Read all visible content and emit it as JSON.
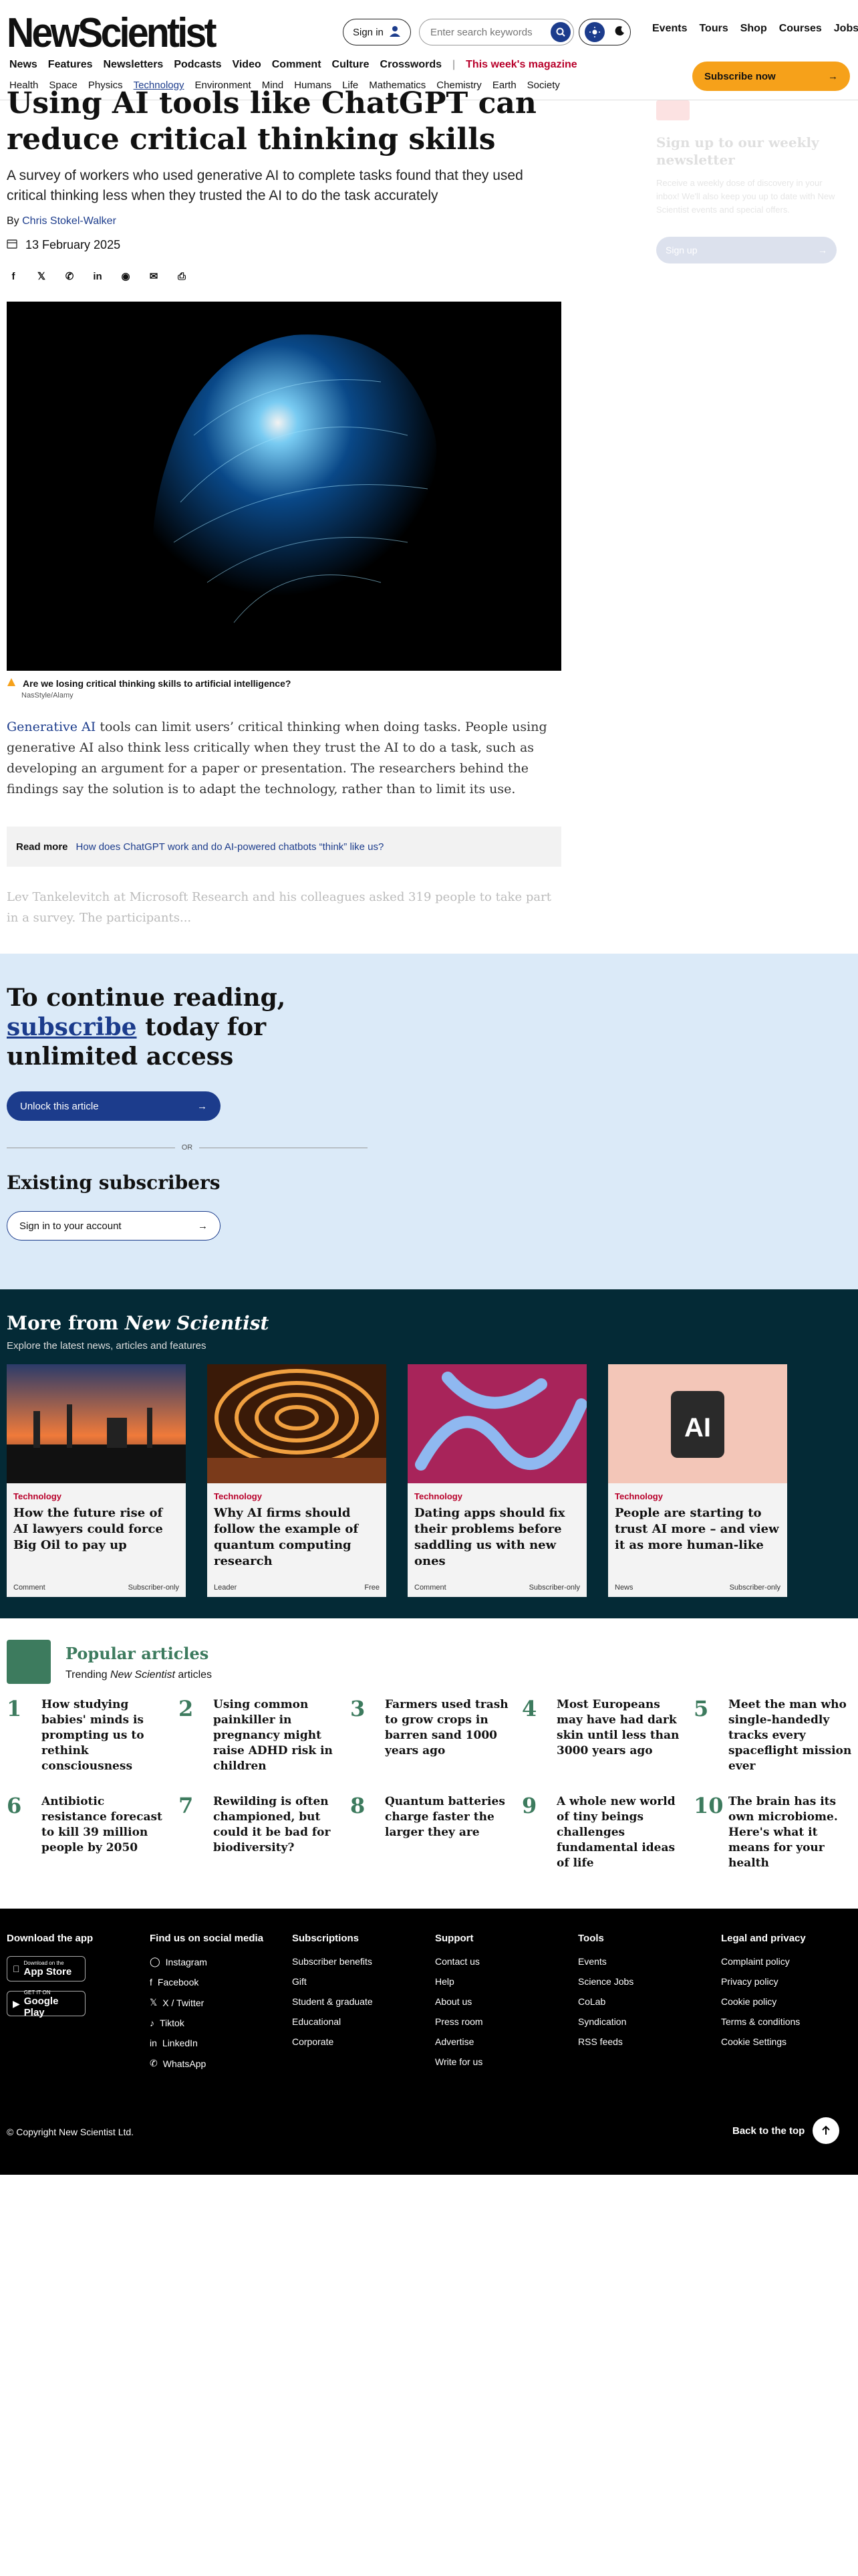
{
  "header": {
    "logo": "NewScientist",
    "signin_label": "Sign in",
    "search_placeholder": "Enter search keywords",
    "top_links": [
      "Events",
      "Tours",
      "Shop",
      "Courses",
      "Jobs"
    ],
    "nav_primary": [
      "News",
      "Features",
      "Newsletters",
      "Podcasts",
      "Video",
      "Comment",
      "Culture",
      "Crosswords"
    ],
    "magazine_link": "This week's magazine",
    "nav_secondary": [
      "Health",
      "Space",
      "Physics",
      "Technology",
      "Environment",
      "Mind",
      "Humans",
      "Life",
      "Mathematics",
      "Chemistry",
      "Earth",
      "Society"
    ],
    "active_section": "Technology",
    "subscribe_label": "Subscribe now"
  },
  "article": {
    "headline": "Using AI tools like ChatGPT can reduce critical thinking skills",
    "standfirst": "A survey of workers who used generative AI to complete tasks found that they used critical thinking less when they trusted the AI to do the task accurately",
    "byline_prefix": "By",
    "author": "Chris Stokel-Walker",
    "date": "13 February 2025",
    "caption": "Are we losing critical thinking skills to artificial intelligence?",
    "credit": "NasStyle/Alamy",
    "body_link": "Generative AI",
    "body_text": " tools can limit users’ critical thinking when doing tasks. People using generative AI also think less critically when they trust the AI to do a task, such as developing an argument for a paper or presentation. The researchers behind the findings say the solution is to adapt the technology, rather than to limit its use.",
    "read_more_label": "Read more",
    "read_more_link": "How does ChatGPT work and do AI-powered chatbots “think” like us?",
    "faded_text_link": "Lev Tankelevitch",
    "faded_text": " at Microsoft Research and his colleagues asked 319 people to take part in a survey. The participants..."
  },
  "sidebar": {
    "title": "Sign up to our weekly newsletter",
    "text": "Receive a weekly dose of discovery in your inbox! We'll also keep you up to date with New Scientist events and special offers.",
    "button": "Sign up"
  },
  "paywall": {
    "line1": "To continue reading,",
    "subscribe_word": "subscribe",
    "line2_rest": " today for unlimited access",
    "unlock_label": "Unlock this article",
    "or_label": "OR",
    "existing_title": "Existing subscribers",
    "signin_account_label": "Sign in to your account"
  },
  "more": {
    "title_prefix": "More from ",
    "title_brand": "New Scientist",
    "subtitle": "Explore the latest news, articles and features",
    "cards": [
      {
        "category": "Technology",
        "title": "How the future rise of AI lawyers could force Big Oil to pay up",
        "type": "Comment",
        "access": "Subscriber-only"
      },
      {
        "category": "Technology",
        "title": "Why AI firms should follow the example of quantum computing research",
        "type": "Leader",
        "access": "Free"
      },
      {
        "category": "Technology",
        "title": "Dating apps should fix their problems before saddling us with new ones",
        "type": "Comment",
        "access": "Subscriber-only"
      },
      {
        "category": "Technology",
        "title": "People are starting to trust AI more – and view it as more human-like",
        "type": "News",
        "access": "Subscriber-only"
      }
    ]
  },
  "popular": {
    "title": "Popular articles",
    "subtitle_prefix": "Trending ",
    "subtitle_brand": "New Scientist",
    "subtitle_suffix": " articles",
    "items": [
      {
        "num": "1",
        "title": "How studying babies' minds is prompting us to rethink consciousness"
      },
      {
        "num": "2",
        "title": "Using common painkiller in pregnancy might raise ADHD risk in children"
      },
      {
        "num": "3",
        "title": "Farmers used trash to grow crops in barren sand 1000 years ago"
      },
      {
        "num": "4",
        "title": "Most Europeans may have had dark skin until less than 3000 years ago"
      },
      {
        "num": "5",
        "title": "Meet the man who single-handedly tracks every spaceflight mission ever"
      },
      {
        "num": "6",
        "title": "Antibiotic resistance forecast to kill 39 million people by 2050"
      },
      {
        "num": "7",
        "title": "Rewilding is often championed, but could it be bad for biodiversity?"
      },
      {
        "num": "8",
        "title": "Quantum batteries charge faster the larger they are"
      },
      {
        "num": "9",
        "title": "A whole new world of tiny beings challenges fundamental ideas of life"
      },
      {
        "num": "10",
        "title": "The brain has its own microbiome. Here's what it means for your health"
      }
    ]
  },
  "footer": {
    "app_title": "Download the app",
    "app_store_small": "Download on the",
    "app_store_big": "App Store",
    "google_small": "GET IT ON",
    "google_big": "Google Play",
    "social_title": "Find us on social media",
    "social": [
      "Instagram",
      "Facebook",
      "X / Twitter",
      "Tiktok",
      "LinkedIn",
      "WhatsApp"
    ],
    "subs_title": "Subscriptions",
    "subs": [
      "Subscriber benefits",
      "Gift",
      "Student & graduate",
      "Educational",
      "Corporate"
    ],
    "support_title": "Support",
    "support": [
      "Contact us",
      "Help",
      "About us",
      "Press room",
      "Advertise",
      "Write for us"
    ],
    "tools_title": "Tools",
    "tools": [
      "Events",
      "Science Jobs",
      "CoLab",
      "Syndication",
      "RSS feeds"
    ],
    "legal_title": "Legal and privacy",
    "legal": [
      "Complaint policy",
      "Privacy policy",
      "Cookie policy",
      "Terms & conditions",
      "Cookie Settings"
    ],
    "copyright": "© Copyright New Scientist Ltd.",
    "back_top": "Back to the top"
  },
  "colors": {
    "brand_blue": "#1c3c8c",
    "subscribe_orange": "#f6a11a",
    "popular_green": "#3d7b5e",
    "more_bg": "#042a36",
    "paywall_bg": "#dbeaf8",
    "category_red": "#b8002a"
  }
}
